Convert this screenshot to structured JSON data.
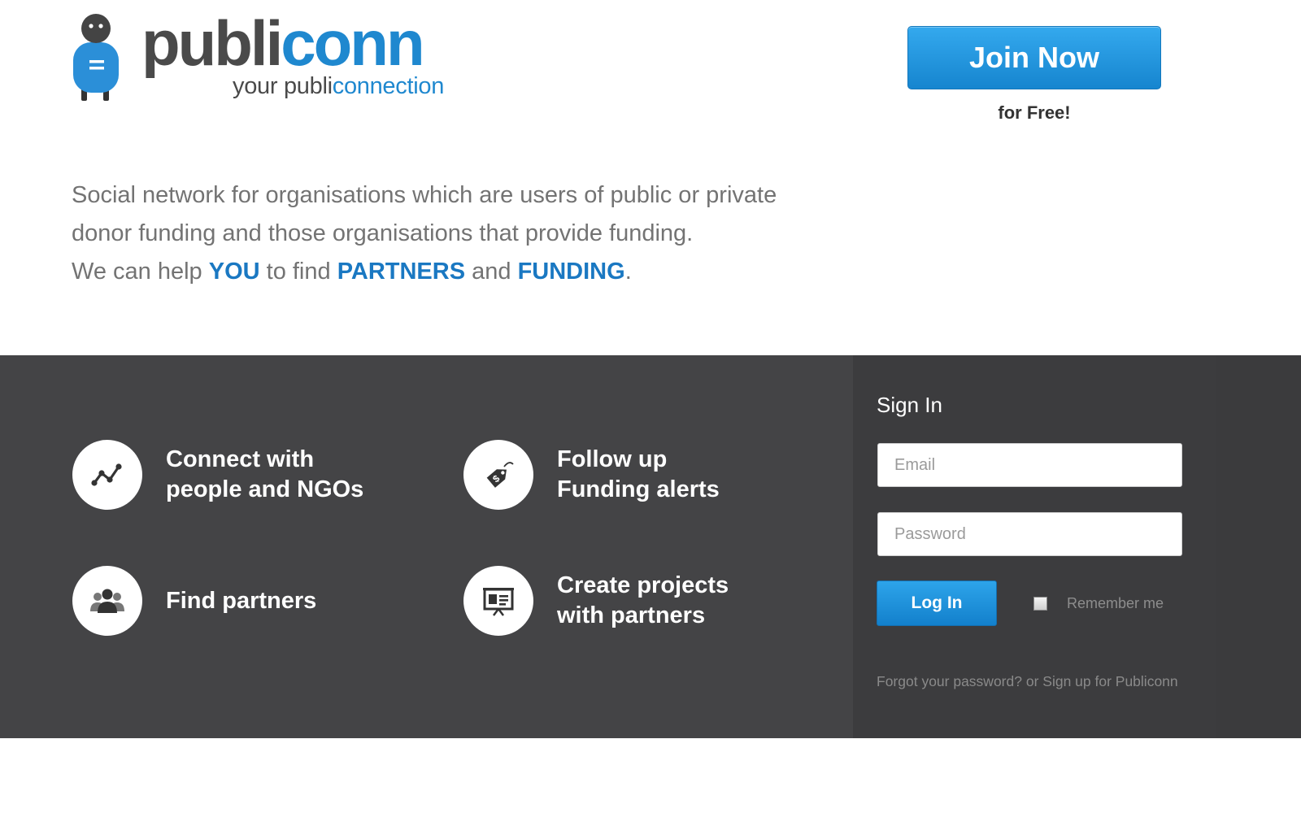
{
  "brand": {
    "name_dark": "publi",
    "name_blue": "conn",
    "tagline_dark": "your publi",
    "tagline_blue": "connection",
    "color_dark": "#4a4a4a",
    "color_blue": "#1f88cf"
  },
  "header": {
    "join_button": "Join Now",
    "join_subtext": "for Free!"
  },
  "intro": {
    "line1": "Social network for organisations which are users of public or private",
    "line2": "donor funding and those organisations that provide funding.",
    "line3_a": "We can help ",
    "highlight_you": "YOU",
    "line3_b": " to find ",
    "highlight_partners": "PARTNERS",
    "line3_c": " and ",
    "highlight_funding": "FUNDING",
    "line3_d": "."
  },
  "features": [
    {
      "icon": "network-graph-icon",
      "line1": "Connect with",
      "line2": "people and NGOs"
    },
    {
      "icon": "price-tag-icon",
      "line1": "Follow up",
      "line2": "Funding alerts"
    },
    {
      "icon": "people-group-icon",
      "line1": "Find partners",
      "line2": ""
    },
    {
      "icon": "presentation-board-icon",
      "line1": "Create projects",
      "line2": "with partners"
    }
  ],
  "signin": {
    "title": "Sign In",
    "email_placeholder": "Email",
    "password_placeholder": "Password",
    "login_button": "Log In",
    "remember_label": "Remember me",
    "forgot_link": "Forgot your password?",
    "or_text": " or ",
    "signup_link": "Sign up for Publiconn"
  },
  "colors": {
    "accent": "#1f88cf",
    "band": "#444446",
    "panel": "#3c3c3e"
  }
}
